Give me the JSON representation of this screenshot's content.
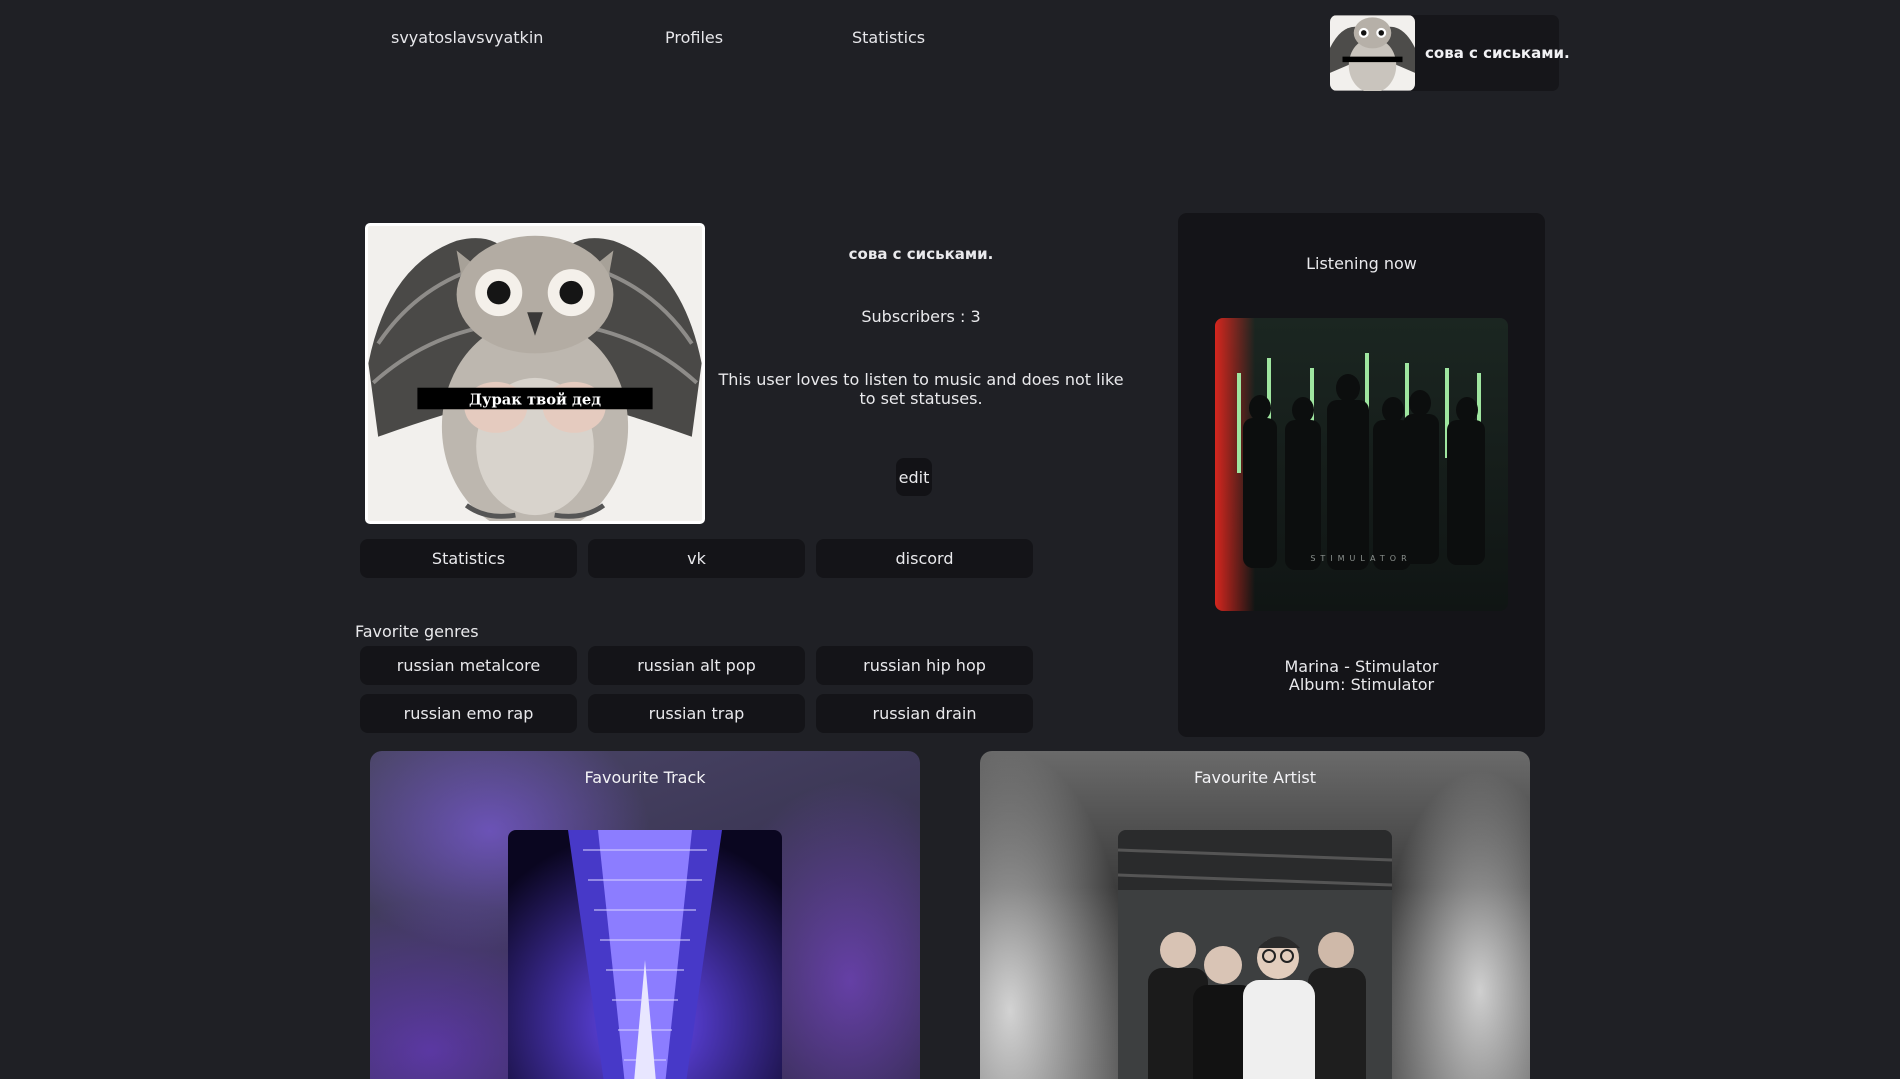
{
  "nav": {
    "username": "svyatoslavsvyatkin",
    "profiles": "Profiles",
    "statistics": "Statistics",
    "current_user": "сова с сиськами."
  },
  "profile": {
    "name": "сова с сиськами.",
    "subscribers": "Subscribers : 3",
    "status": "This user loves to listen to music and does not like to set statuses.",
    "edit_label": "edit",
    "avatar_caption": "Дурак твой дед",
    "links": [
      "Statistics",
      "vk",
      "discord"
    ]
  },
  "genres": {
    "title": "Favorite genres",
    "items": [
      "russian metalcore",
      "russian alt pop",
      "russian hip hop",
      "russian emo rap",
      "russian trap",
      "russian drain"
    ]
  },
  "listening": {
    "title": "Listening now",
    "track": "Marina - Stimulator",
    "album": "Album: Stimulator",
    "cover_text": "STIMULATOR"
  },
  "favourites": {
    "track_title": "Favourite Track",
    "artist_title": "Favourite Artist"
  }
}
